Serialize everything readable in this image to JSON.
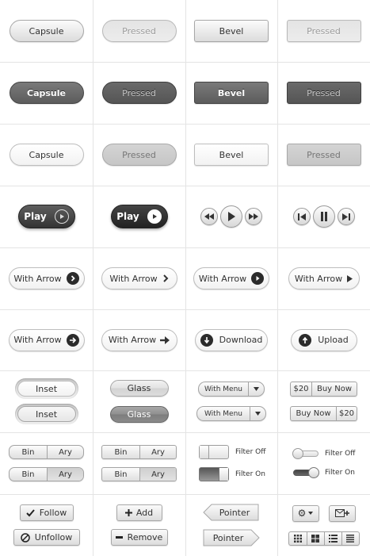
{
  "rows": {
    "r1": {
      "capsule": "Capsule",
      "capsule_pressed": "Pressed",
      "bevel": "Bevel",
      "bevel_pressed": "Pressed"
    },
    "r2": {
      "capsule": "Capsule",
      "capsule_pressed": "Pressed",
      "bevel": "Bevel",
      "bevel_pressed": "Pressed"
    },
    "r3": {
      "capsule": "Capsule",
      "capsule_pressed": "Pressed",
      "bevel": "Bevel",
      "bevel_pressed": "Pressed"
    },
    "r4": {
      "play": "Play",
      "play_pressed": "Play"
    },
    "r5": {
      "a": "With Arrow",
      "b": "With Arrow",
      "c": "With Arrow",
      "d": "With Arrow"
    },
    "r6": {
      "a": "With Arrow",
      "b": "With Arrow",
      "download": "Download",
      "upload": "Upload"
    },
    "r7": {
      "inset": "Inset",
      "inset_pressed": "Inset",
      "glass": "Glass",
      "glass_pressed": "Glass",
      "menu1": "With Menu",
      "menu2": "With Menu",
      "price1": "$20",
      "buy1": "Buy Now",
      "buy2": "Buy Now",
      "price2": "$20"
    },
    "r8": {
      "bin": "Bin",
      "ary": "Ary",
      "filter_off": "Filter Off",
      "filter_on": "Filter On"
    },
    "r9": {
      "follow": "Follow",
      "unfollow": "Unfollow",
      "add": "Add",
      "remove": "Remove",
      "pointer": "Pointer"
    }
  },
  "icons": [
    "play-icon",
    "rewind-icon",
    "fast-forward-icon",
    "pause-icon",
    "skip-back-icon",
    "skip-forward-icon",
    "chevron-right-icon",
    "arrow-right-icon",
    "download-icon",
    "upload-icon",
    "menu-arrow-icon",
    "check-icon",
    "no-icon",
    "plus-icon",
    "minus-icon",
    "gear-icon",
    "mail-icon",
    "grid-view-icon",
    "list-view-icon"
  ],
  "colors": {
    "dark_button": "#5c5c5c",
    "border": "#a7a7a7",
    "grid_line": "#e4e4e4"
  }
}
